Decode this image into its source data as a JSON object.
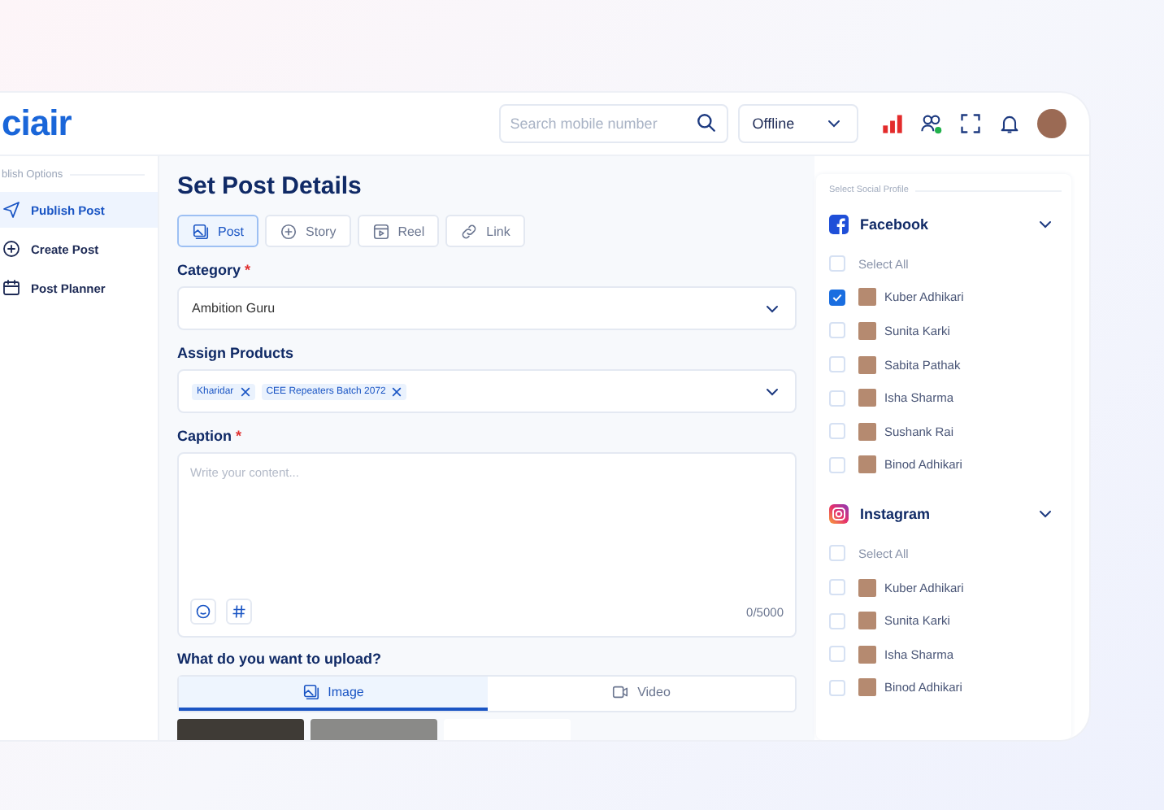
{
  "logo": "ciair",
  "header": {
    "search": {
      "placeholder": "Search mobile number"
    },
    "status_select": {
      "value": "Offline"
    }
  },
  "sidebar": {
    "section_title": "blish Options",
    "items": [
      {
        "label": "Publish Post",
        "selected": true
      },
      {
        "label": "Create Post",
        "selected": false
      },
      {
        "label": "Post Planner",
        "selected": false
      }
    ]
  },
  "main": {
    "title": "Set Post Details",
    "post_types": [
      {
        "label": "Post",
        "selected": true
      },
      {
        "label": "Story",
        "selected": false
      },
      {
        "label": "Reel",
        "selected": false
      },
      {
        "label": "Link",
        "selected": false
      }
    ],
    "category": {
      "label": "Category",
      "required_mark": "*",
      "value": "Ambition Guru"
    },
    "products": {
      "label": "Assign Products",
      "tags": [
        "Kharidar",
        "CEE Repeaters Batch 2072"
      ]
    },
    "caption": {
      "label": "Caption",
      "required_mark": "*",
      "placeholder": "Write your content...",
      "counter": "0/5000"
    },
    "upload": {
      "label": "What do you want to upload?",
      "tabs": [
        {
          "label": "Image",
          "selected": true
        },
        {
          "label": "Video",
          "selected": false
        }
      ]
    }
  },
  "social": {
    "title": "Select Social Profile",
    "networks": [
      {
        "name": "Facebook",
        "kind": "facebook",
        "expanded": true,
        "select_all": {
          "label": "Select All",
          "checked": false
        },
        "profiles": [
          {
            "name": "Kuber Adhikari",
            "checked": true
          },
          {
            "name": "Sunita Karki",
            "checked": false
          },
          {
            "name": "Sabita Pathak",
            "checked": false
          },
          {
            "name": "Isha Sharma",
            "checked": false
          },
          {
            "name": "Sushank Rai",
            "checked": false
          },
          {
            "name": "Binod Adhikari",
            "checked": false
          }
        ]
      },
      {
        "name": "Instagram",
        "kind": "instagram",
        "expanded": true,
        "select_all": {
          "label": "Select All",
          "checked": false
        },
        "profiles": [
          {
            "name": "Kuber Adhikari",
            "checked": false
          },
          {
            "name": "Sunita Karki",
            "checked": false
          },
          {
            "name": "Isha Sharma",
            "checked": false
          },
          {
            "name": "Binod Adhikari",
            "checked": false
          }
        ]
      }
    ]
  }
}
